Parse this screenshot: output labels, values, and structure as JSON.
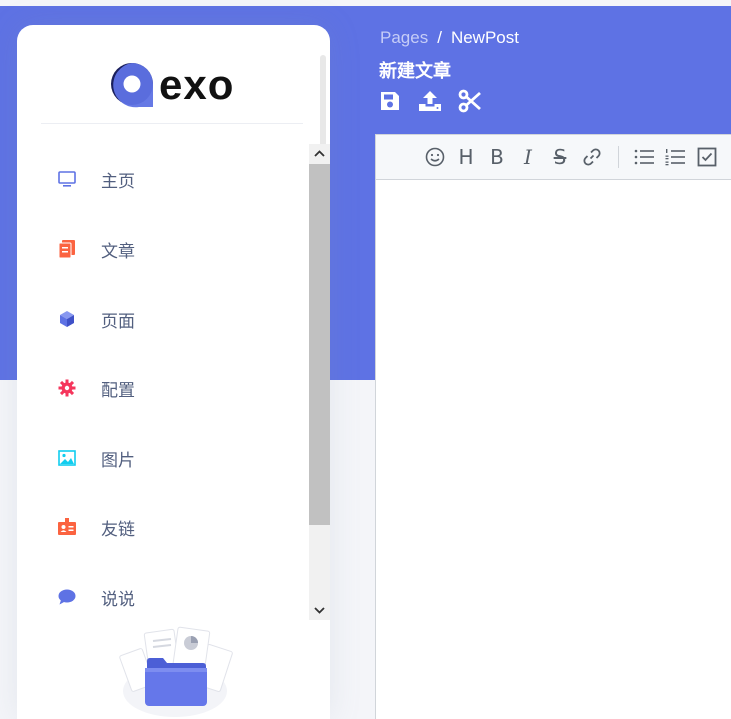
{
  "brand": {
    "logo_text": "exo",
    "colors": {
      "q_dark": "#1a1f5c",
      "q_light": "#5e72e4"
    }
  },
  "sidebar": {
    "items": [
      {
        "label": "主页",
        "icon": "monitor-icon",
        "color": "#5e72e4"
      },
      {
        "label": "文章",
        "icon": "article-icon",
        "color": "#fb6340"
      },
      {
        "label": "页面",
        "icon": "cube-icon",
        "color": "#5e72e4"
      },
      {
        "label": "配置",
        "icon": "gear-icon",
        "color": "#f5365c"
      },
      {
        "label": "图片",
        "icon": "image-icon",
        "color": "#11cdef"
      },
      {
        "label": "友链",
        "icon": "badge-icon",
        "color": "#fb6340"
      },
      {
        "label": "说说",
        "icon": "chat-bubble-icon",
        "color": "#5e72e4"
      }
    ]
  },
  "header": {
    "breadcrumb": {
      "parent": "Pages",
      "separator": "/",
      "current": "NewPost"
    },
    "title": "新建文章",
    "actions": [
      "save-icon",
      "upload-icon",
      "scissors-icon"
    ]
  },
  "editor": {
    "toolbar": [
      {
        "name": "emoji-icon"
      },
      {
        "name": "heading",
        "text": "H"
      },
      {
        "name": "bold",
        "text": "B"
      },
      {
        "name": "italic",
        "text": "I"
      },
      {
        "name": "strikethrough",
        "text": "S"
      },
      {
        "name": "link-icon"
      },
      {
        "name": "unordered-list-icon"
      },
      {
        "name": "ordered-list-icon"
      },
      {
        "name": "checklist-icon"
      }
    ],
    "content": ""
  },
  "colors": {
    "primary": "#5e72e4",
    "bg": "#f4f5f9",
    "text": "#525f7f"
  }
}
